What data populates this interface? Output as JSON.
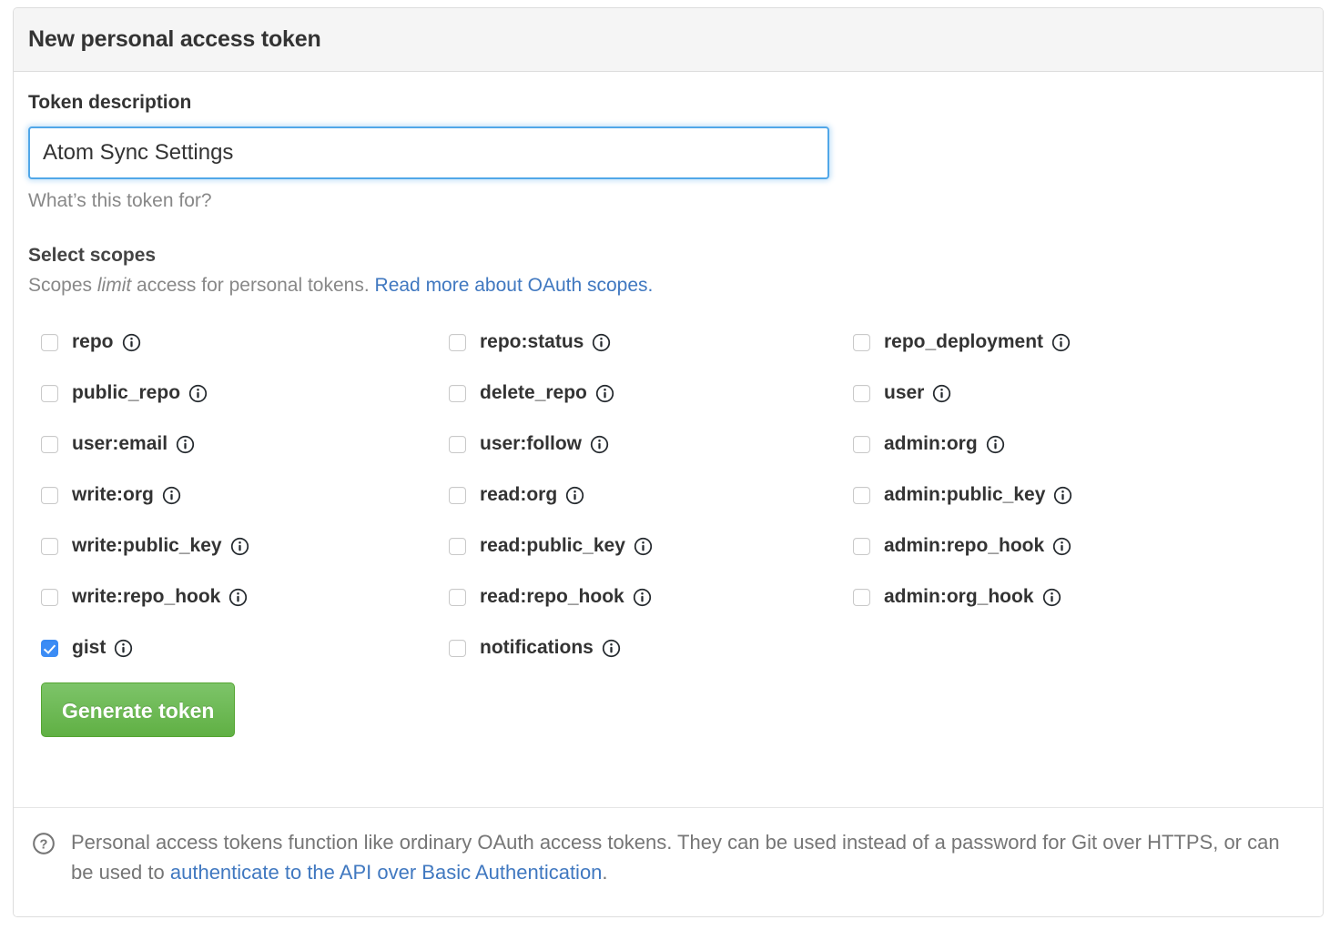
{
  "header": {
    "title": "New personal access token"
  },
  "form": {
    "token_description_label": "Token description",
    "token_description_value": "Atom Sync Settings",
    "token_description_placeholder": "",
    "token_description_help": "What’s this token for?",
    "scopes_heading": "Select scopes",
    "scopes_sub_prefix": "Scopes ",
    "scopes_sub_em": "limit",
    "scopes_sub_mid": " access for personal tokens. ",
    "scopes_sub_link": "Read more about OAuth scopes.",
    "generate_label": "Generate token"
  },
  "scopes": {
    "columns": [
      {
        "items": [
          {
            "name": "repo",
            "checked": false
          },
          {
            "name": "public_repo",
            "checked": false
          },
          {
            "name": "user:email",
            "checked": false
          },
          {
            "name": "write:org",
            "checked": false
          },
          {
            "name": "write:public_key",
            "checked": false
          },
          {
            "name": "write:repo_hook",
            "checked": false
          },
          {
            "name": "gist",
            "checked": true
          }
        ]
      },
      {
        "items": [
          {
            "name": "repo:status",
            "checked": false
          },
          {
            "name": "delete_repo",
            "checked": false
          },
          {
            "name": "user:follow",
            "checked": false
          },
          {
            "name": "read:org",
            "checked": false
          },
          {
            "name": "read:public_key",
            "checked": false
          },
          {
            "name": "read:repo_hook",
            "checked": false
          },
          {
            "name": "notifications",
            "checked": false
          }
        ]
      },
      {
        "items": [
          {
            "name": "repo_deployment",
            "checked": false
          },
          {
            "name": "user",
            "checked": false
          },
          {
            "name": "admin:org",
            "checked": false
          },
          {
            "name": "admin:public_key",
            "checked": false
          },
          {
            "name": "admin:repo_hook",
            "checked": false
          },
          {
            "name": "admin:org_hook",
            "checked": false
          }
        ]
      }
    ]
  },
  "footer": {
    "text_part1": "Personal access tokens function like ordinary OAuth access tokens. They can be used instead of a password for Git over HTTPS, or can be used to ",
    "link": "authenticate to the API over Basic Authentication",
    "text_part2": "."
  },
  "colors": {
    "accent_blue": "#4078c0",
    "focus_blue": "#51a7e8",
    "checkbox_blue": "#3b8cf5",
    "button_green": "#60b044",
    "header_bg": "#f5f5f5",
    "muted_text": "#888888"
  },
  "icons": {
    "info": "info-icon",
    "question": "question-icon"
  }
}
